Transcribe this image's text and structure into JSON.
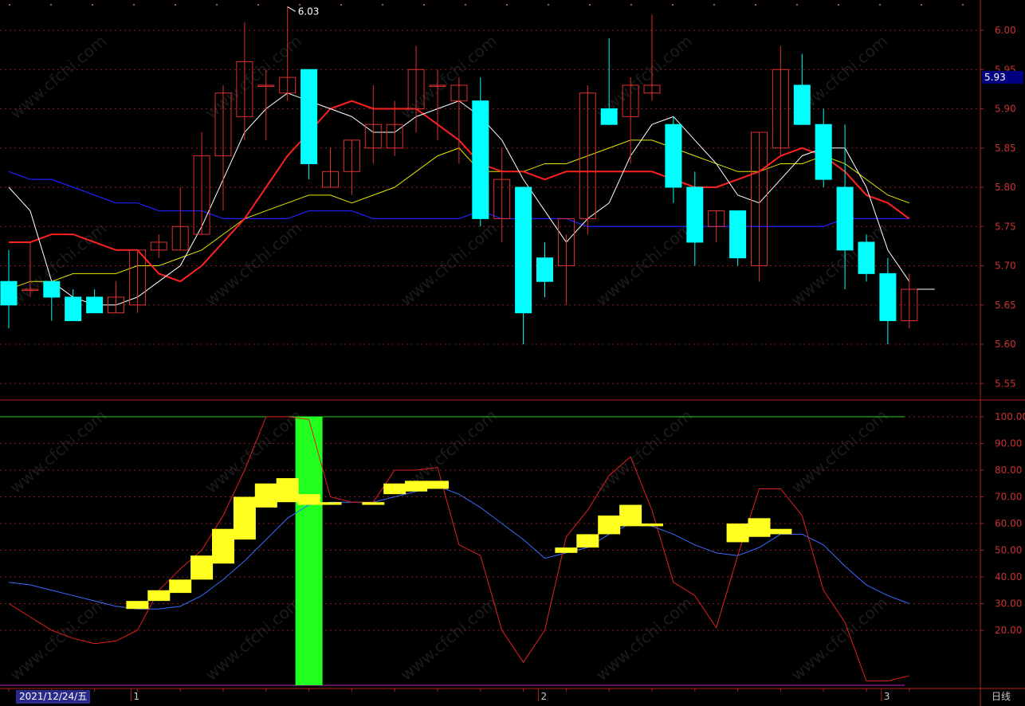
{
  "chart_data": [
    {
      "type": "candlestick",
      "title": "",
      "period_label": "日线",
      "current_date": "2021/12/24/五",
      "last_price_tag": "5.93",
      "max_annotation": "6.03",
      "ylim": [
        5.52,
        6.03
      ],
      "y_ticks": [
        "6.00",
        "5.95",
        "5.90",
        "5.85",
        "5.80",
        "5.75",
        "5.70",
        "5.65",
        "5.60",
        "5.55"
      ],
      "x_tick_labels": [
        "1",
        "2",
        "3"
      ],
      "grid": true,
      "colors": {
        "up": "#e03030",
        "down": "#00ffff",
        "ma5": "#ffffff",
        "ma10": "#e6e600",
        "ma20": "#ff2020",
        "ma60": "#2020ff"
      },
      "candles": [
        {
          "o": 5.68,
          "h": 5.72,
          "l": 5.62,
          "c": 5.65
        },
        {
          "o": 5.67,
          "h": 5.73,
          "l": 5.66,
          "c": 5.67
        },
        {
          "o": 5.68,
          "h": 5.68,
          "l": 5.63,
          "c": 5.66
        },
        {
          "o": 5.66,
          "h": 5.67,
          "l": 5.63,
          "c": 5.63
        },
        {
          "o": 5.66,
          "h": 5.67,
          "l": 5.64,
          "c": 5.64
        },
        {
          "o": 5.64,
          "h": 5.68,
          "l": 5.64,
          "c": 5.66
        },
        {
          "o": 5.65,
          "h": 5.72,
          "l": 5.64,
          "c": 5.72
        },
        {
          "o": 5.72,
          "h": 5.74,
          "l": 5.71,
          "c": 5.73
        },
        {
          "o": 5.72,
          "h": 5.8,
          "l": 5.72,
          "c": 5.75
        },
        {
          "o": 5.74,
          "h": 5.87,
          "l": 5.74,
          "c": 5.84
        },
        {
          "o": 5.84,
          "h": 5.93,
          "l": 5.77,
          "c": 5.92
        },
        {
          "o": 5.89,
          "h": 6.01,
          "l": 5.86,
          "c": 5.96
        },
        {
          "o": 5.93,
          "h": 5.95,
          "l": 5.86,
          "c": 5.93
        },
        {
          "o": 5.92,
          "h": 6.03,
          "l": 5.91,
          "c": 5.94
        },
        {
          "o": 5.95,
          "h": 5.95,
          "l": 5.81,
          "c": 5.83
        },
        {
          "o": 5.8,
          "h": 5.85,
          "l": 5.8,
          "c": 5.82
        },
        {
          "o": 5.82,
          "h": 5.86,
          "l": 5.79,
          "c": 5.86
        },
        {
          "o": 5.85,
          "h": 5.93,
          "l": 5.83,
          "c": 5.88
        },
        {
          "o": 5.85,
          "h": 5.91,
          "l": 5.84,
          "c": 5.88
        },
        {
          "o": 5.9,
          "h": 5.98,
          "l": 5.87,
          "c": 5.95
        },
        {
          "o": 5.93,
          "h": 5.95,
          "l": 5.86,
          "c": 5.93
        },
        {
          "o": 5.91,
          "h": 5.94,
          "l": 5.83,
          "c": 5.93
        },
        {
          "o": 5.91,
          "h": 5.94,
          "l": 5.75,
          "c": 5.76
        },
        {
          "o": 5.76,
          "h": 5.85,
          "l": 5.73,
          "c": 5.81
        },
        {
          "o": 5.8,
          "h": 5.8,
          "l": 5.6,
          "c": 5.64
        },
        {
          "o": 5.71,
          "h": 5.73,
          "l": 5.66,
          "c": 5.68
        },
        {
          "o": 5.7,
          "h": 5.74,
          "l": 5.65,
          "c": 5.76
        },
        {
          "o": 5.76,
          "h": 5.93,
          "l": 5.74,
          "c": 5.92
        },
        {
          "o": 5.9,
          "h": 5.99,
          "l": 5.88,
          "c": 5.88
        },
        {
          "o": 5.89,
          "h": 5.94,
          "l": 5.83,
          "c": 5.93
        },
        {
          "o": 5.92,
          "h": 6.02,
          "l": 5.91,
          "c": 5.93
        },
        {
          "o": 5.88,
          "h": 5.89,
          "l": 5.78,
          "c": 5.8
        },
        {
          "o": 5.8,
          "h": 5.82,
          "l": 5.7,
          "c": 5.73
        },
        {
          "o": 5.75,
          "h": 5.77,
          "l": 5.73,
          "c": 5.77
        },
        {
          "o": 5.77,
          "h": 5.77,
          "l": 5.7,
          "c": 5.71
        },
        {
          "o": 5.7,
          "h": 5.87,
          "l": 5.68,
          "c": 5.87
        },
        {
          "o": 5.85,
          "h": 5.98,
          "l": 5.84,
          "c": 5.95
        },
        {
          "o": 5.93,
          "h": 5.97,
          "l": 5.88,
          "c": 5.88
        },
        {
          "o": 5.88,
          "h": 5.9,
          "l": 5.8,
          "c": 5.81
        },
        {
          "o": 5.8,
          "h": 5.88,
          "l": 5.67,
          "c": 5.72
        },
        {
          "o": 5.73,
          "h": 5.74,
          "l": 5.68,
          "c": 5.69
        },
        {
          "o": 5.69,
          "h": 5.71,
          "l": 5.6,
          "c": 5.63
        },
        {
          "o": 5.63,
          "h": 5.69,
          "l": 5.62,
          "c": 5.67
        }
      ],
      "ma_lines": {
        "ma5": [
          5.8,
          5.77,
          5.68,
          5.66,
          5.65,
          5.65,
          5.66,
          5.68,
          5.7,
          5.75,
          5.81,
          5.87,
          5.9,
          5.92,
          5.91,
          5.9,
          5.89,
          5.87,
          5.87,
          5.89,
          5.9,
          5.91,
          5.89,
          5.86,
          5.81,
          5.77,
          5.73,
          5.76,
          5.78,
          5.84,
          5.88,
          5.89,
          5.86,
          5.83,
          5.79,
          5.78,
          5.81,
          5.84,
          5.85,
          5.85,
          5.8,
          5.72,
          5.68
        ],
        "ma10": [
          5.67,
          5.68,
          5.68,
          5.69,
          5.69,
          5.69,
          5.7,
          5.7,
          5.71,
          5.72,
          5.74,
          5.76,
          5.77,
          5.78,
          5.79,
          5.79,
          5.78,
          5.79,
          5.8,
          5.82,
          5.84,
          5.85,
          5.82,
          5.82,
          5.82,
          5.83,
          5.83,
          5.84,
          5.85,
          5.86,
          5.86,
          5.85,
          5.84,
          5.83,
          5.82,
          5.82,
          5.83,
          5.83,
          5.84,
          5.83,
          5.81,
          5.79,
          5.78
        ],
        "ma20": [
          5.73,
          5.73,
          5.74,
          5.74,
          5.73,
          5.72,
          5.72,
          5.69,
          5.68,
          5.7,
          5.73,
          5.76,
          5.8,
          5.84,
          5.87,
          5.9,
          5.91,
          5.9,
          5.9,
          5.9,
          5.88,
          5.86,
          5.83,
          5.82,
          5.82,
          5.81,
          5.82,
          5.82,
          5.82,
          5.82,
          5.82,
          5.81,
          5.8,
          5.8,
          5.81,
          5.82,
          5.84,
          5.85,
          5.84,
          5.82,
          5.79,
          5.78,
          5.76
        ],
        "ma60": [
          5.82,
          5.81,
          5.81,
          5.8,
          5.79,
          5.78,
          5.78,
          5.77,
          5.77,
          5.77,
          5.76,
          5.76,
          5.76,
          5.76,
          5.77,
          5.77,
          5.77,
          5.76,
          5.76,
          5.76,
          5.76,
          5.76,
          5.77,
          5.76,
          5.76,
          5.76,
          5.76,
          5.75,
          5.75,
          5.75,
          5.75,
          5.75,
          5.75,
          5.75,
          5.75,
          5.75,
          5.75,
          5.75,
          5.75,
          5.76,
          5.76,
          5.76,
          5.76
        ]
      }
    },
    {
      "type": "line",
      "title": "",
      "ylim": [
        0,
        100
      ],
      "y_ticks": [
        "100.00",
        "90.00",
        "80.00",
        "70.00",
        "60.00",
        "50.00",
        "40.00",
        "30.00",
        "20.00"
      ],
      "reference_level": 100,
      "colors": {
        "fast": "#e02020",
        "slow": "#3a6aff",
        "block": "#ffff20",
        "signal": "#20ff20",
        "ref": "#20d020"
      },
      "signal_bar_index": 14,
      "fast_line": [
        30,
        25,
        20,
        17,
        15,
        16,
        20,
        35,
        43,
        50,
        63,
        80,
        100,
        100,
        99,
        70,
        68,
        68,
        80,
        80,
        81,
        52,
        48,
        20,
        8,
        20,
        55,
        65,
        78,
        85,
        65,
        38,
        33,
        21,
        48,
        73,
        73,
        63,
        35,
        23,
        1,
        1,
        3
      ],
      "slow_line": [
        38,
        37,
        35,
        33,
        31,
        29,
        28,
        28,
        29,
        33,
        39,
        46,
        54,
        62,
        67,
        68,
        68,
        68,
        70,
        72,
        74,
        71,
        66,
        60,
        54,
        47,
        49,
        51,
        56,
        60,
        59,
        56,
        52,
        49,
        48,
        51,
        56,
        56,
        52,
        44,
        37,
        33,
        30
      ],
      "blocks": [
        {
          "i": 6,
          "from": 28,
          "to": 31
        },
        {
          "i": 7,
          "from": 31,
          "to": 35
        },
        {
          "i": 8,
          "from": 34,
          "to": 39
        },
        {
          "i": 9,
          "from": 39,
          "to": 48
        },
        {
          "i": 10,
          "from": 45,
          "to": 58
        },
        {
          "i": 11,
          "from": 54,
          "to": 70
        },
        {
          "i": 12,
          "from": 66,
          "to": 75
        },
        {
          "i": 13,
          "from": 68,
          "to": 77
        },
        {
          "i": 14,
          "from": 67,
          "to": 71
        },
        {
          "i": 15,
          "from": 67,
          "to": 68
        },
        {
          "i": 17,
          "from": 67,
          "to": 68
        },
        {
          "i": 18,
          "from": 71,
          "to": 75
        },
        {
          "i": 19,
          "from": 72,
          "to": 76
        },
        {
          "i": 20,
          "from": 73,
          "to": 76
        },
        {
          "i": 26,
          "from": 49,
          "to": 51
        },
        {
          "i": 27,
          "from": 51,
          "to": 56
        },
        {
          "i": 28,
          "from": 56,
          "to": 63
        },
        {
          "i": 29,
          "from": 59,
          "to": 67
        },
        {
          "i": 30,
          "from": 59,
          "to": 60
        },
        {
          "i": 34,
          "from": 53,
          "to": 60
        },
        {
          "i": 35,
          "from": 55,
          "to": 62
        },
        {
          "i": 36,
          "from": 56,
          "to": 58
        }
      ]
    }
  ],
  "watermark": "www.cfchi.com"
}
